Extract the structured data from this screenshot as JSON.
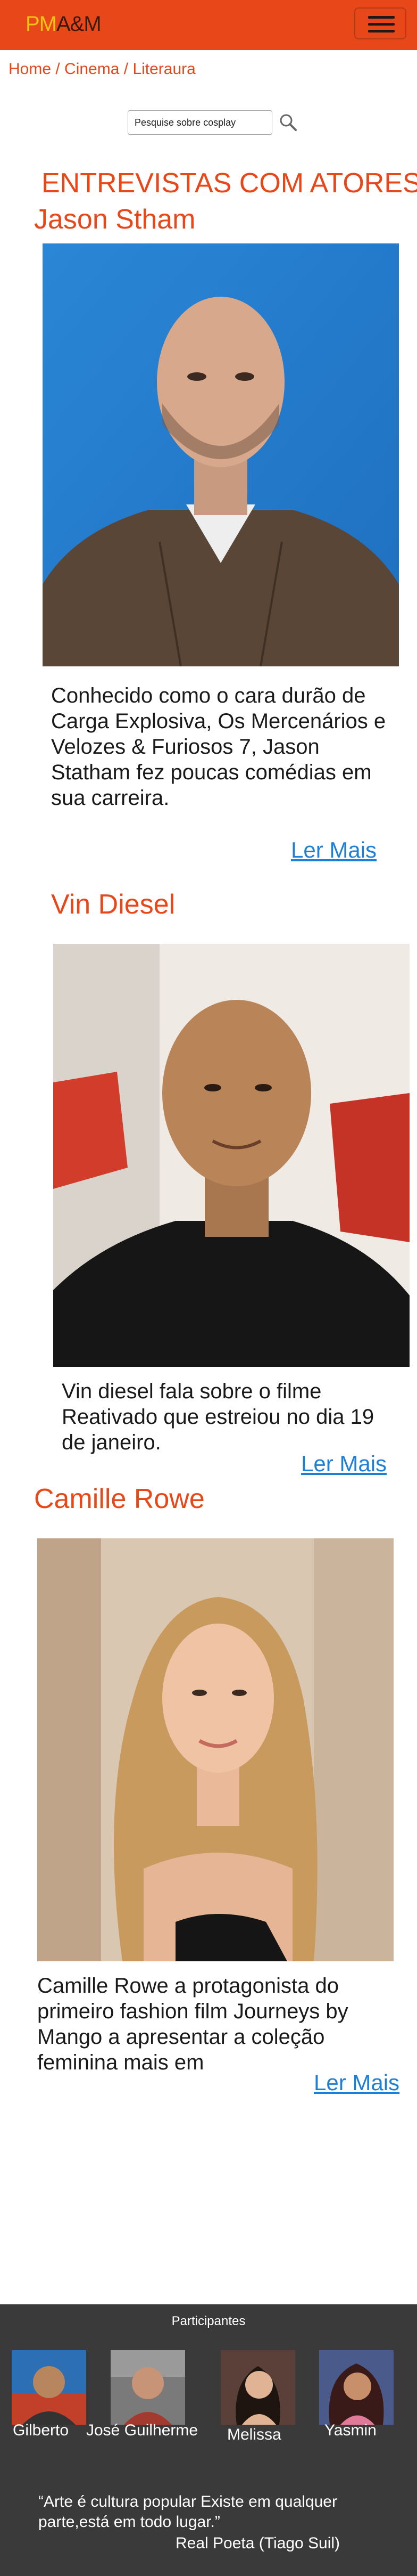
{
  "navbar": {
    "brand_pm": "PM",
    "brand_am": "A&M",
    "menu_icon": "hamburger-icon",
    "colors": {
      "background": "#e8471a",
      "brand_pm": "#f2c215",
      "brand_am": "#3a1a0a"
    }
  },
  "breadcrumb": {
    "items": [
      "Home",
      "Cinema",
      "Literaura"
    ],
    "separator": " / "
  },
  "search": {
    "placeholder": "Pesquise sobre cosplay",
    "icon": "search-icon"
  },
  "section_title": "ENTREVISTAS COM ATORES",
  "actors": [
    {
      "name": "Jason Stham",
      "description": "Conhecido como o cara durão de Carga Explosiva, Os Mercenários e Velozes & Furiosos 7, Jason Statham fez poucas comédias em sua carreira.",
      "read_more": "Ler Mais"
    },
    {
      "name": "Vin Diesel",
      "description": "Vin diesel fala sobre o filme Reativado que estreiou no dia 19 de janeiro.",
      "read_more": "Ler Mais"
    },
    {
      "name": "Camille Rowe",
      "description": "Camille Rowe a protagonista do primeiro fashion film Journeys by Mango a apresentar a coleção feminina mais em",
      "read_more": "Ler Mais"
    }
  ],
  "footer": {
    "title": "Participantes",
    "participants": [
      "Gilberto",
      "José Guilherme",
      "Melissa",
      "Yasmin"
    ],
    "quote": "“Arte é cultura popular Existe em qualquer parte,está em todo lugar.”",
    "quote_author": "Real Poeta (Tiago Suil)",
    "colors": {
      "background": "#3a3a3a"
    }
  },
  "colors": {
    "accent": "#e8471a",
    "link": "#1e7fd6"
  }
}
